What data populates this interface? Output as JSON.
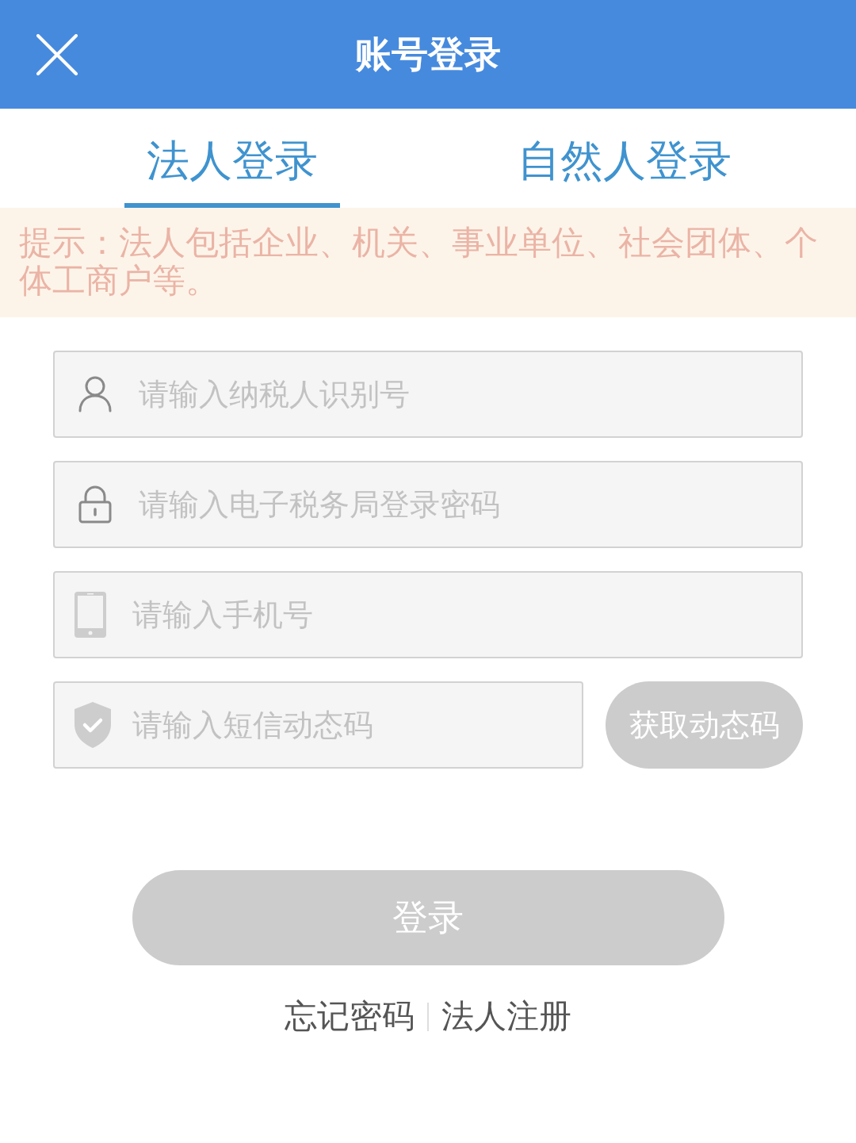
{
  "header": {
    "title": "账号登录"
  },
  "tabs": [
    {
      "label": "法人登录",
      "selected": true
    },
    {
      "label": "自然人登录",
      "selected": false
    }
  ],
  "notice": "提示：法人包括企业、机关、事业单位、社会团体、个体工商户等。",
  "fields": [
    {
      "kind": "user",
      "placeholder": "请输入纳税人识别号"
    },
    {
      "kind": "lock",
      "placeholder": "请输入电子税务局登录密码"
    },
    {
      "kind": "phone",
      "placeholder": "请输入手机号"
    },
    {
      "kind": "shield",
      "placeholder": "请输入短信动态码",
      "button": {
        "label": "获取动态码",
        "disabled": true
      }
    }
  ],
  "login_button": {
    "label": "登录",
    "disabled": true
  },
  "links": [
    "忘记密码",
    "法人注册"
  ]
}
